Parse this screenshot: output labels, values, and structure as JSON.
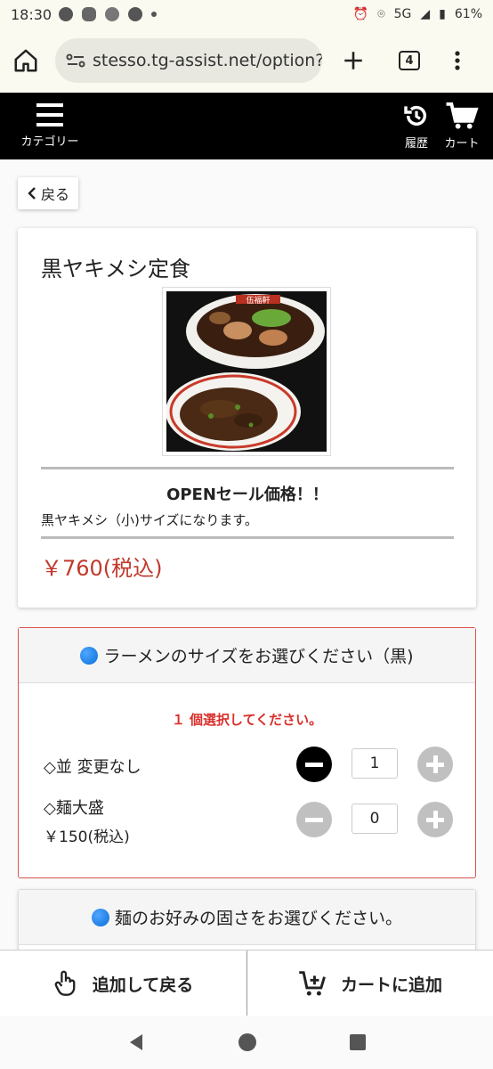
{
  "status_bar": {
    "time": "18:30",
    "network": "5G",
    "battery": "61%"
  },
  "browser": {
    "url": "stesso.tg-assist.net/option?",
    "tab_count": "4"
  },
  "navbar": {
    "category_label": "カテゴリー",
    "history_label": "履歴",
    "cart_label": "カート"
  },
  "back_label": "戻る",
  "product": {
    "title": "黒ヤキメシ定食",
    "sale_text": "OPENセール価格！！",
    "description": "黒ヤキメシ（小)サイズになります。",
    "price": "￥760(税込)",
    "image_alt": "伍福軒"
  },
  "option1": {
    "heading": "ラーメンのサイズをお選びください（黒)",
    "note": "１ 個選択してください。",
    "items": [
      {
        "label": "◇並  変更なし",
        "price": "",
        "qty": "1"
      },
      {
        "label": "◇麺大盛",
        "price": "￥150(税込)",
        "qty": "0"
      }
    ]
  },
  "option2": {
    "heading": "麺のお好みの固さをお選びください。"
  },
  "bottom": {
    "add_back_label": "追加して戻る",
    "add_cart_label": "カートに追加"
  },
  "colors": {
    "price_red": "#c0392b",
    "border_red": "#d9534f",
    "navbar_bg": "#000000",
    "accent_blue": "#0a6fd8"
  },
  "icons": [
    "home-icon",
    "site-settings-icon",
    "plus-icon",
    "menu-dots-icon",
    "hamburger-icon",
    "history-icon",
    "cart-icon",
    "chevron-left-icon",
    "hand-pointer-icon",
    "cart-plus-icon"
  ]
}
